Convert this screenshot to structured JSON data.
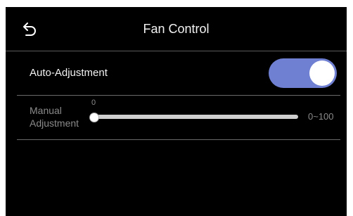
{
  "header": {
    "title": "Fan Control",
    "back_icon": "back-arrow-icon"
  },
  "auto_adjustment": {
    "label": "Auto-Adjustment",
    "enabled": true,
    "toggle_color": "#6f7fd2"
  },
  "manual_adjustment": {
    "label_line1": "Manual",
    "label_line2": "Adjustment",
    "value": "0",
    "range": "0~100"
  }
}
